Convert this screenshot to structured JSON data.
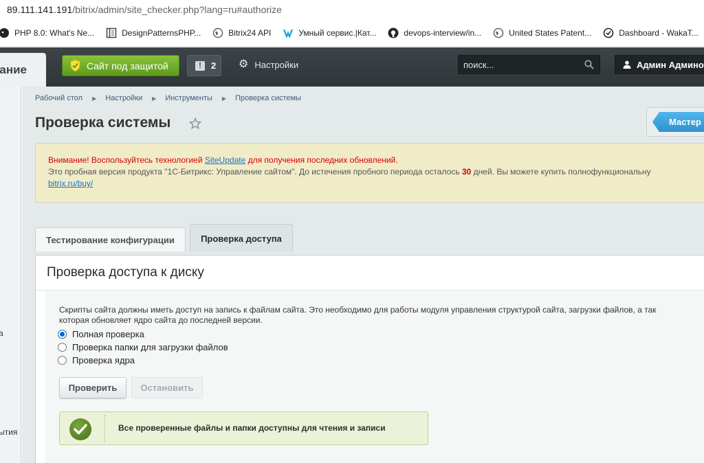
{
  "browser": {
    "address_host": "89.111.141.191",
    "address_path": "/bitrix/admin/site_checker.php?lang=ru#authorize",
    "bookmarks": [
      {
        "label": "PHP 8.0: What's Ne...",
        "icon": "elephant-icon"
      },
      {
        "label": "DesignPatternsPHP...",
        "icon": "book-icon"
      },
      {
        "label": "Bitrix24 API",
        "icon": "globe-icon"
      },
      {
        "label": "Умный сервис.|Кат...",
        "icon": "brand-icon"
      },
      {
        "label": "devops-interview/in...",
        "icon": "github-icon"
      },
      {
        "label": "United States Patent...",
        "icon": "globe-icon"
      },
      {
        "label": "Dashboard - WakaT...",
        "icon": "clock-icon"
      }
    ]
  },
  "topbar": {
    "title_fragment": "ание",
    "secure_label": "Сайт под защитой",
    "notifications_count": "2",
    "settings_label": "Настройки",
    "search_placeholder": "поиск...",
    "user_name": "Админ Админов"
  },
  "sidebar": {
    "fragments": [
      "а",
      "ытия"
    ]
  },
  "breadcrumb": [
    "Рабочий стол",
    "Настройки",
    "Инструменты",
    "Проверка системы"
  ],
  "page_title": "Проверка системы",
  "master_label": "Мастер",
  "notice": {
    "warning_before": "Внимание! Воспользуйтесь технологией ",
    "warning_link": "SiteUpdate",
    "warning_after": " для получения последних обновлений.",
    "info_before": "Это пробная версия продукта \"1С-Битрикс: Управление сайтом\". До истечения пробного периода осталось ",
    "info_days": "30",
    "info_after": " дней. Вы можете купить полнофункциональну",
    "buy_link": "bitrix.ru/buy/"
  },
  "tabs": [
    "Тестирование конфигурации",
    "Проверка доступа"
  ],
  "panel": {
    "title": "Проверка доступа к диску",
    "description_line1": "Скрипты сайта должны иметь доступ на запись к файлам сайта. Это необходимо для работы модуля управления структурой сайта, загрузки файлов, а так",
    "description_line2": "которая обновляет ядро сайта до последней версии.",
    "options": [
      "Полная проверка",
      "Проверка папки для загрузки файлов",
      "Проверка ядра"
    ],
    "selected_option": "Полная проверка",
    "check_button": "Проверить",
    "stop_button": "Остановить",
    "success_message": "Все проверенные файлы и папки доступны для чтения и записи"
  },
  "colors": {
    "accent_green": "#6aab22",
    "warning_red": "#d30000",
    "link_blue": "#1d6fbd",
    "master_blue": "#3aa3de"
  }
}
